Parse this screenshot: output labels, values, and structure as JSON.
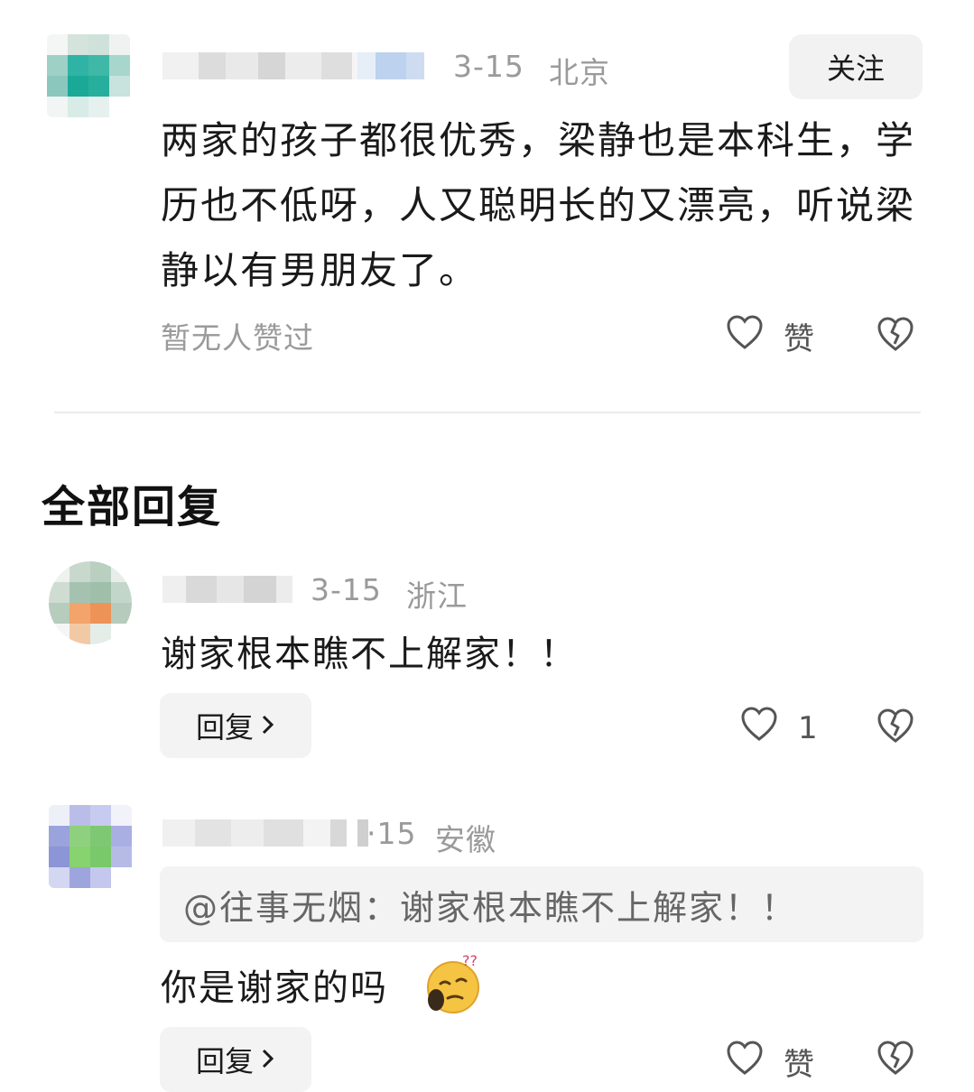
{
  "comment": {
    "date": "3-15",
    "location": "北京",
    "follow_label": "关注",
    "text": "两家的孩子都很优秀，梁静也是本科生，学历也不低呀，人又聪明长的又漂亮，听说梁静以有男朋友了。",
    "likes_status": "暂无人赞过",
    "like_label": "赞"
  },
  "replies_section": {
    "title": "全部回复"
  },
  "replies": [
    {
      "date": "3-15",
      "location": "浙江",
      "text": "谢家根本瞧不上解家！！",
      "reply_label": "回复",
      "like_count": "1"
    },
    {
      "date": "·15",
      "location": "安徽",
      "quote": "@往事无烟：谢家根本瞧不上解家！！",
      "text": "你是谢家的吗",
      "emoji_icon": "thinking-face-icon",
      "reply_label": "回复",
      "like_label": "赞"
    }
  ],
  "colors": {
    "text": "#1a1a1a",
    "meta": "#9a9a9a",
    "button_bg": "#f2f2f2"
  }
}
